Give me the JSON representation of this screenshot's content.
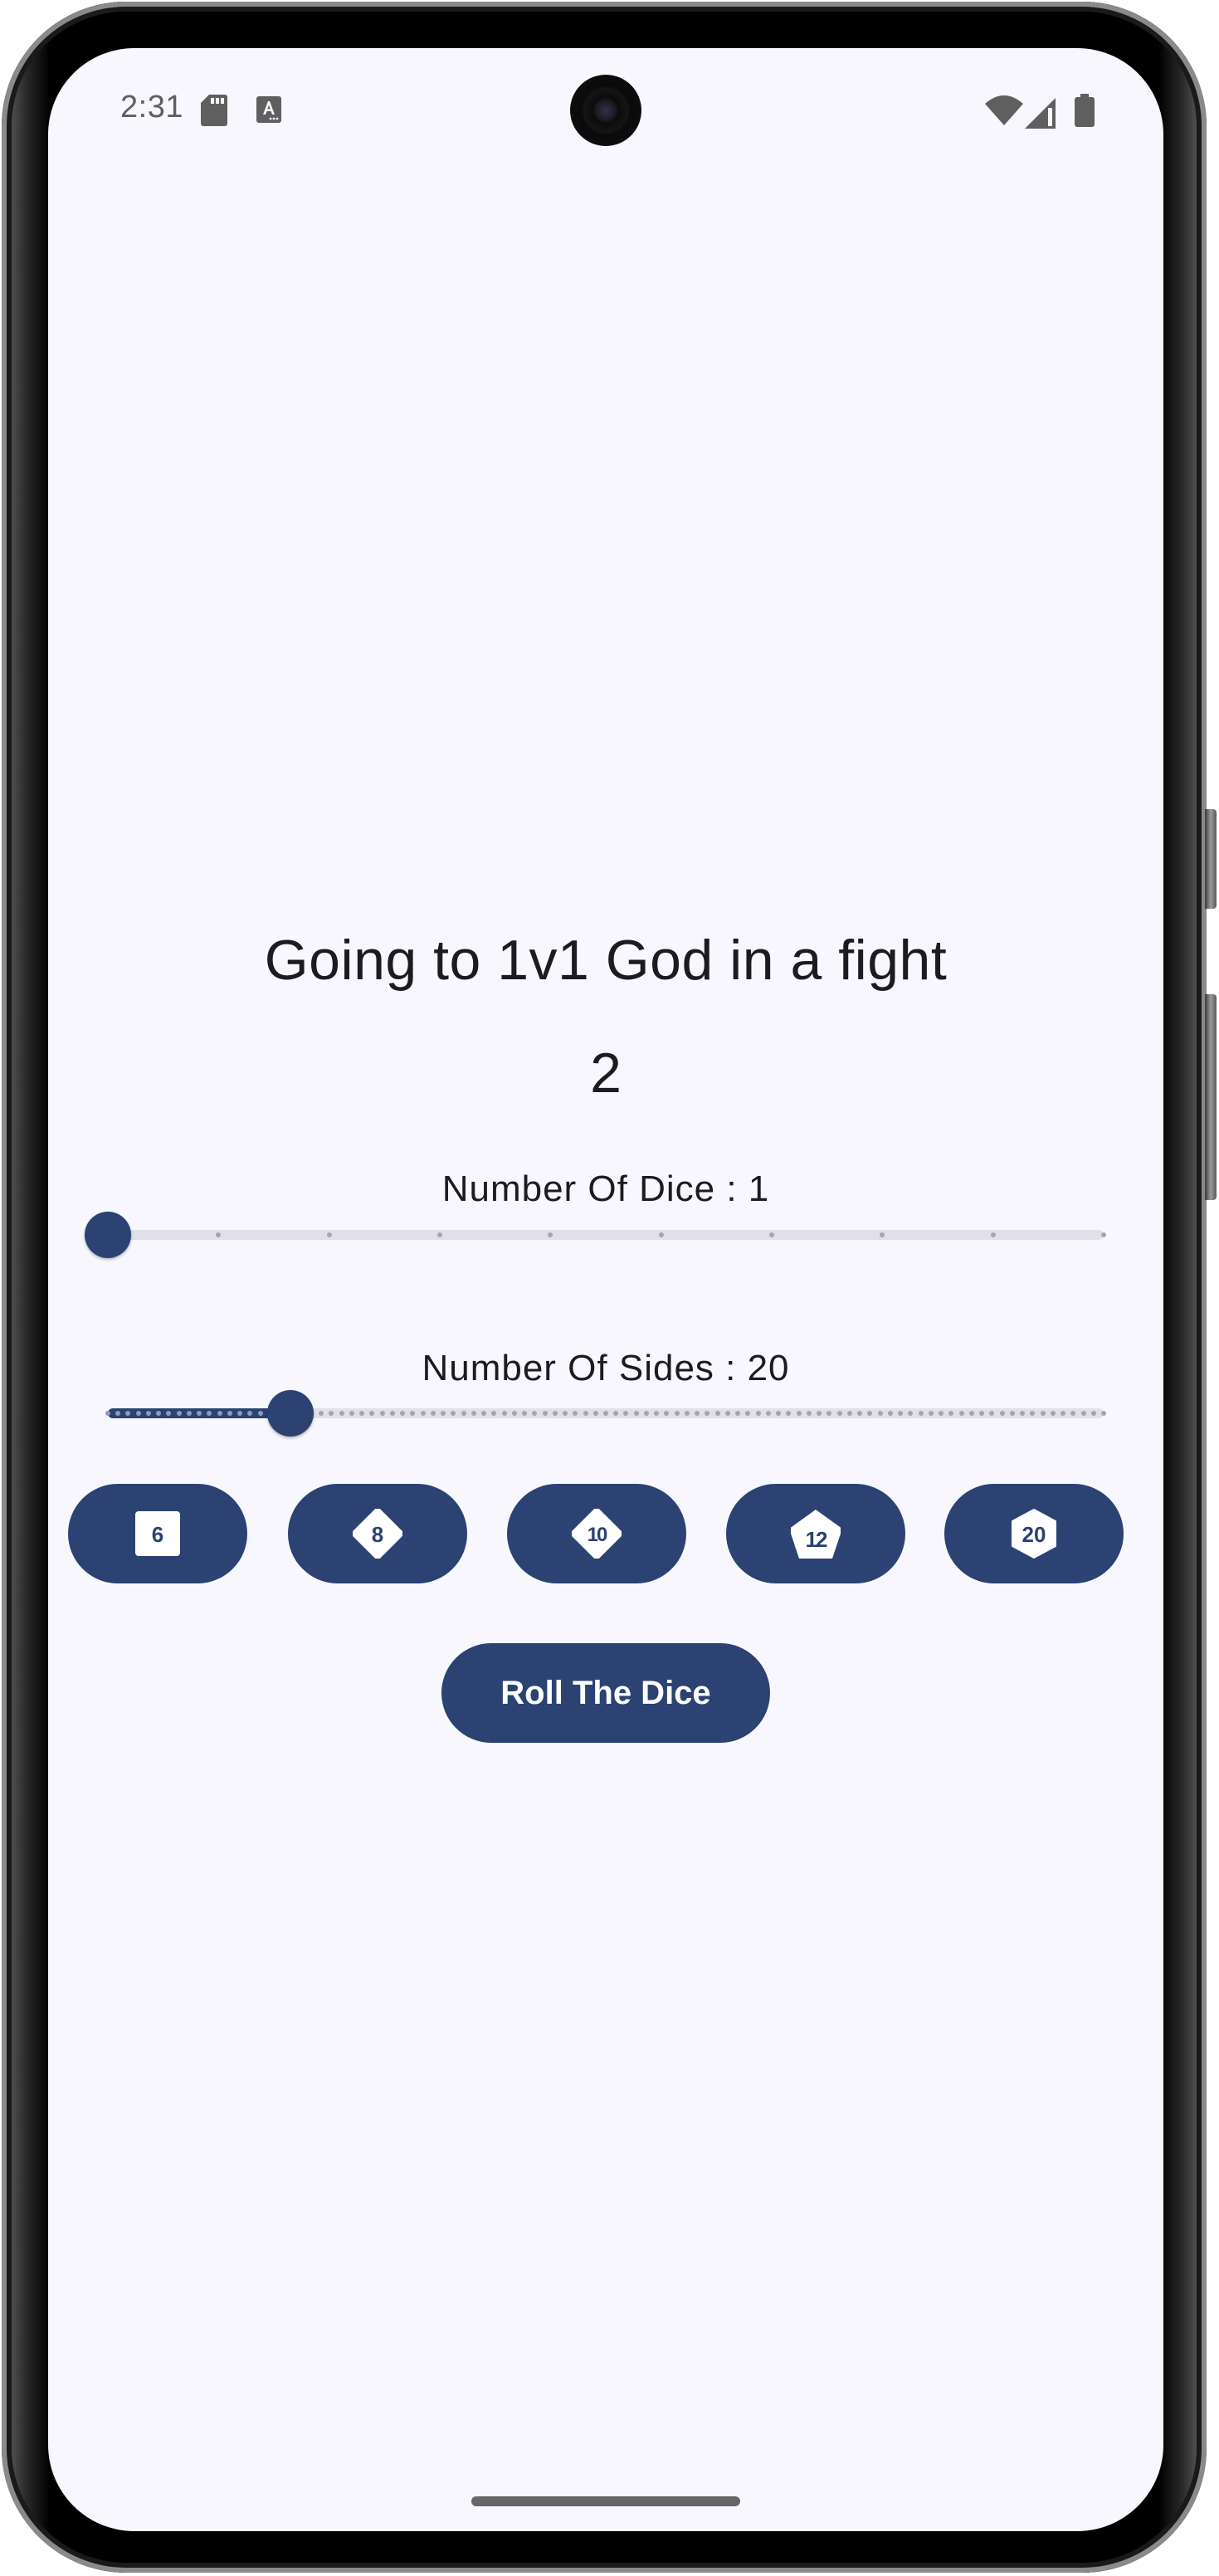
{
  "status_bar": {
    "time": "2:31",
    "left_icons": [
      "sd-card-icon",
      "accessibility-font-icon"
    ],
    "right_icons": [
      "wifi-icon",
      "cellular-signal-icon",
      "battery-icon"
    ]
  },
  "main": {
    "title": "Going to 1v1 God in a fight",
    "result": "2",
    "dice_count": {
      "label": "Number Of Dice : 1",
      "value": 1,
      "min": 1,
      "max": 10
    },
    "sides_count": {
      "label": "Number Of Sides : 20",
      "value": 20,
      "min": 2,
      "max": 100
    },
    "dice_presets": [
      {
        "label": "6",
        "shape": "square",
        "icon": "d6-icon"
      },
      {
        "label": "8",
        "shape": "diamond",
        "icon": "d8-icon"
      },
      {
        "label": "10",
        "shape": "diamond",
        "icon": "d10-icon"
      },
      {
        "label": "12",
        "shape": "pentagon",
        "icon": "d12-icon"
      },
      {
        "label": "20",
        "shape": "hexagon",
        "icon": "d20-icon"
      }
    ],
    "roll_button": "Roll The Dice"
  },
  "colors": {
    "primary": "#2b4272",
    "background": "#f8f7fd",
    "text": "#1c1b1f",
    "track_inactive": "#e1e0ea"
  }
}
